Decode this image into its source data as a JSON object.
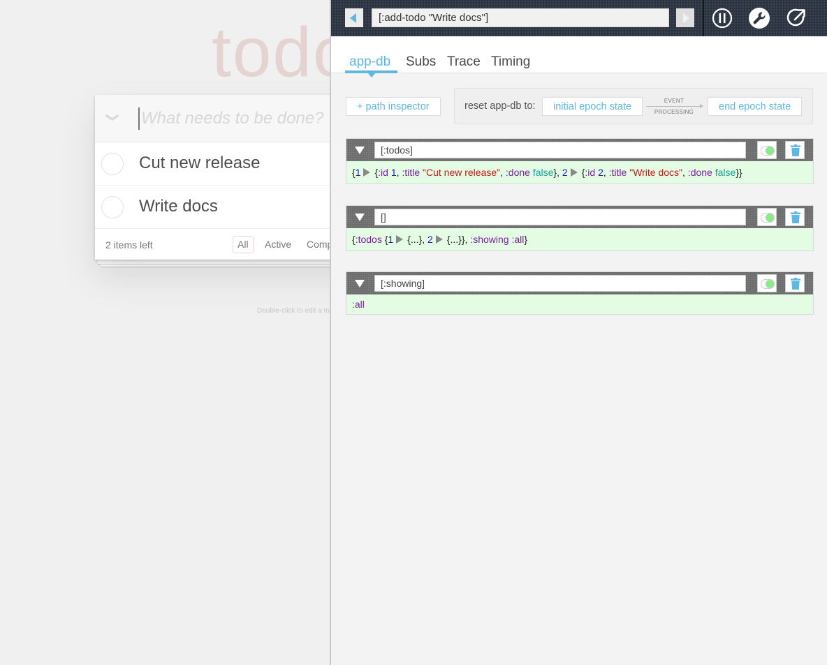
{
  "todo": {
    "title": "todos",
    "placeholder": "What needs to be done?",
    "toggle_all_glyph": "❯",
    "items": [
      {
        "label": "Cut new release"
      },
      {
        "label": "Write docs"
      }
    ],
    "items_left": "2 items left",
    "filters": [
      {
        "label": "All",
        "selected": true
      },
      {
        "label": "Active"
      },
      {
        "label": "Completed"
      }
    ],
    "hint": "Double-click to edit a todo"
  },
  "panel": {
    "event": "[:add-todo \"Write docs\"]",
    "icons": [
      "pause-icon",
      "settings-wrench-icon",
      "popout-icon"
    ],
    "tabs": [
      {
        "label": "app-db",
        "active": true
      },
      {
        "label": "Subs"
      },
      {
        "label": "Trace"
      },
      {
        "label": "Timing"
      }
    ],
    "path_inspector_label": "+ path inspector",
    "reset_label": "reset app-db to:",
    "initial_state_label": "initial epoch state",
    "event_processing_line1": "EVENT",
    "event_processing_line2": "PROCESSING",
    "end_state_label": "end epoch state",
    "inspectors": [
      {
        "path": "[:todos]",
        "tokens": [
          {
            "t": "{",
            "c": "br"
          },
          {
            "t": "1",
            "c": "num"
          },
          {
            "t": "▶",
            "c": "expand"
          },
          {
            "t": "{",
            "c": "br"
          },
          {
            "t": ":id",
            "c": "kw"
          },
          {
            "t": " ",
            "c": "br"
          },
          {
            "t": "1",
            "c": "num"
          },
          {
            "t": ", ",
            "c": "br"
          },
          {
            "t": ":title",
            "c": "kw"
          },
          {
            "t": " ",
            "c": "br"
          },
          {
            "t": "\"Cut new release\"",
            "c": "str"
          },
          {
            "t": ", ",
            "c": "br"
          },
          {
            "t": ":done",
            "c": "kw"
          },
          {
            "t": " ",
            "c": "br"
          },
          {
            "t": "false",
            "c": "bool"
          },
          {
            "t": "}, ",
            "c": "br"
          },
          {
            "t": "2",
            "c": "num"
          },
          {
            "t": "▶",
            "c": "expand"
          },
          {
            "t": "{",
            "c": "br"
          },
          {
            "t": ":id",
            "c": "kw"
          },
          {
            "t": " ",
            "c": "br"
          },
          {
            "t": "2",
            "c": "num"
          },
          {
            "t": ", ",
            "c": "br"
          },
          {
            "t": ":title",
            "c": "kw"
          },
          {
            "t": " ",
            "c": "br"
          },
          {
            "t": "\"Write docs\"",
            "c": "str"
          },
          {
            "t": ", ",
            "c": "br"
          },
          {
            "t": ":done",
            "c": "kw"
          },
          {
            "t": " ",
            "c": "br"
          },
          {
            "t": "false",
            "c": "bool"
          },
          {
            "t": "}}",
            "c": "br"
          }
        ]
      },
      {
        "path": "[]",
        "tokens": [
          {
            "t": "{",
            "c": "br"
          },
          {
            "t": ":todos",
            "c": "kw"
          },
          {
            "t": " {",
            "c": "br"
          },
          {
            "t": "1",
            "c": "num"
          },
          {
            "t": "▶",
            "c": "expand"
          },
          {
            "t": "{...}",
            "c": "br"
          },
          {
            "t": ", ",
            "c": "br"
          },
          {
            "t": "2",
            "c": "num"
          },
          {
            "t": "▶",
            "c": "expand"
          },
          {
            "t": "{...}",
            "c": "br"
          },
          {
            "t": "}, ",
            "c": "br"
          },
          {
            "t": ":showing",
            "c": "kw"
          },
          {
            "t": " ",
            "c": "br"
          },
          {
            "t": ":all",
            "c": "kw"
          },
          {
            "t": "}",
            "c": "br"
          }
        ]
      },
      {
        "path": "[:showing]",
        "tokens": [
          {
            "t": ":all",
            "c": "kw"
          }
        ]
      }
    ]
  },
  "colors": {
    "accent": "#5fb8e1",
    "topbar": "#2d3441",
    "inspector_bg": "#e4fbe4",
    "toggle_on": "#8ee88e"
  }
}
